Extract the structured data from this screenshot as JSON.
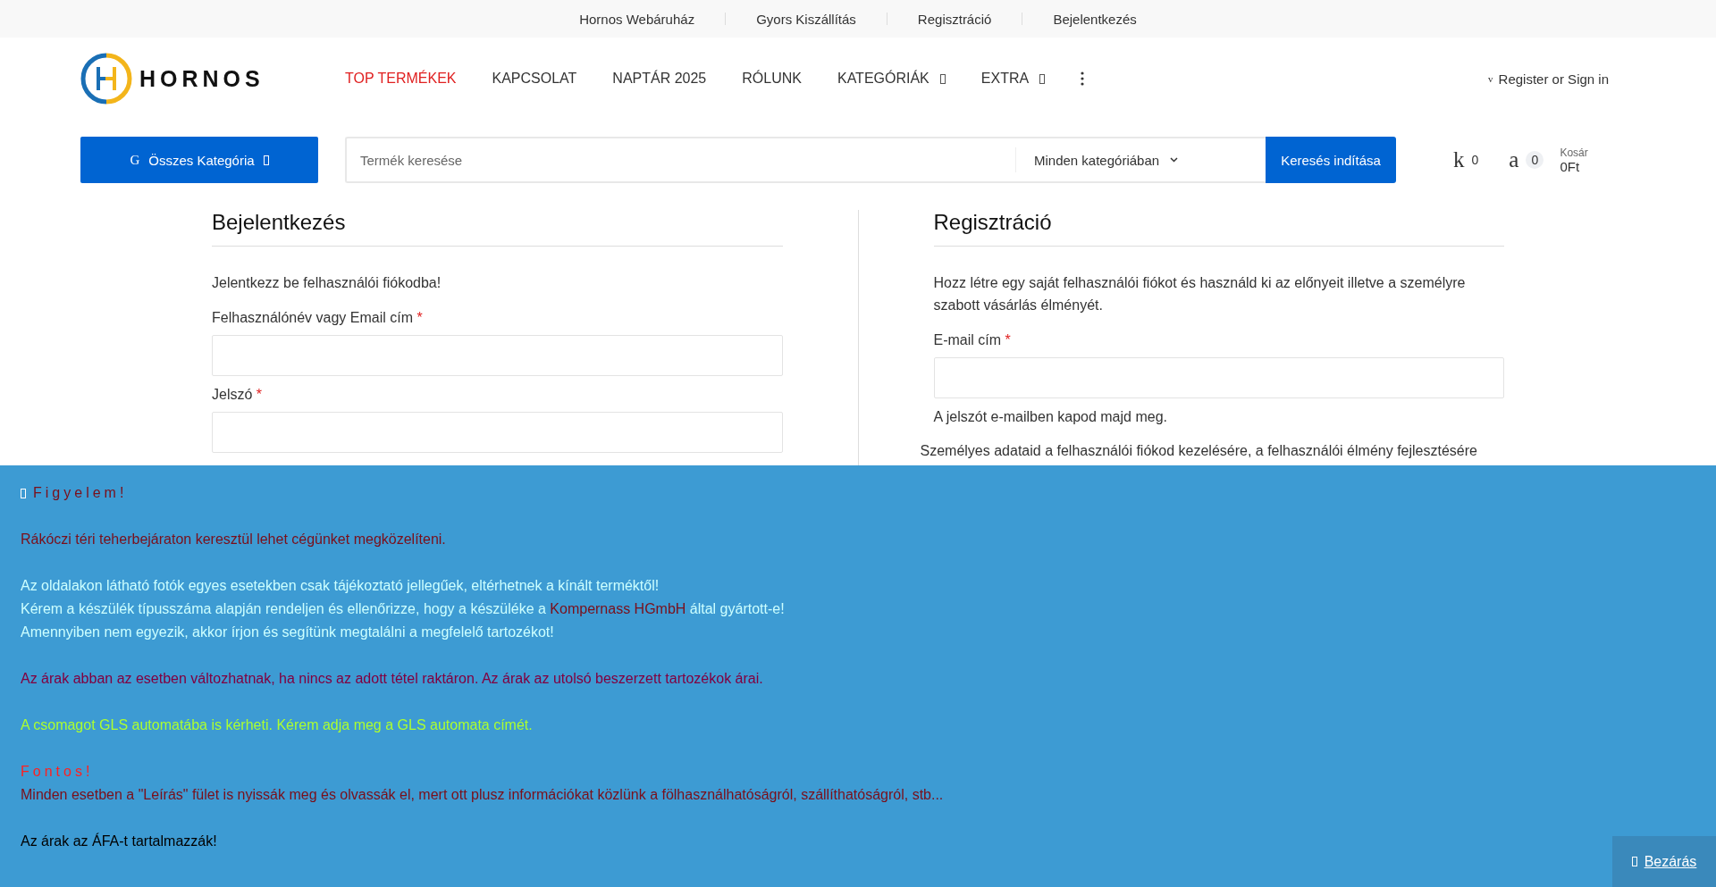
{
  "top_links": [
    "Hornos Webáruház",
    "Gyors Kiszállítás",
    "Regisztráció",
    "Bejelentkezés"
  ],
  "logo": {
    "text": "HORNOS"
  },
  "nav": [
    {
      "label": "TOP TERMÉKEK",
      "highlighted": true,
      "has_dropdown": false
    },
    {
      "label": "KAPCSOLAT",
      "highlighted": false,
      "has_dropdown": false
    },
    {
      "label": "NAPTÁR 2025",
      "highlighted": false,
      "has_dropdown": false
    },
    {
      "label": "RÓLUNK",
      "highlighted": false,
      "has_dropdown": false
    },
    {
      "label": "KATEGÓRIÁK",
      "highlighted": false,
      "has_dropdown": true
    },
    {
      "label": "EXTRA",
      "highlighted": false,
      "has_dropdown": true
    }
  ],
  "account": {
    "glyph": "v",
    "label": "Register or Sign in"
  },
  "category_button": {
    "glyph": "G",
    "label": "Összes Kategória"
  },
  "search": {
    "placeholder": "Termék keresése",
    "category": "Minden kategóriában",
    "button": "Keresés indítása"
  },
  "wishlist": {
    "glyph": "k",
    "count": "0"
  },
  "cart": {
    "glyph": "a",
    "count": "0",
    "label": "Kosár",
    "total": "0Ft"
  },
  "required_mark": "*",
  "login": {
    "title": "Bejelentkezés",
    "intro": "Jelentkezz be felhasználói fiókodba!",
    "fields": [
      {
        "label": "Felhasználónév vagy Email cím",
        "required": true
      },
      {
        "label": "Jelszó",
        "required": true
      }
    ]
  },
  "register": {
    "title": "Regisztráció",
    "intro": "Hozz létre egy saját felhasználói fiókot és használd ki az előnyeit illetve a személyre szabott vásárlás élményét.",
    "fields": [
      {
        "label": "E-mail cím",
        "required": true
      }
    ],
    "note": "A jelszót e-mailben kapod majd meg.",
    "privacy": "Személyes adataid a felhasználói fiókod kezelésére, a felhasználói élmény fejlesztésére"
  },
  "notice": {
    "lines": [
      {
        "kind": "title",
        "segments": [
          {
            "text": "Figyelem!",
            "color": "#7a0f1a"
          }
        ]
      },
      {
        "kind": "blank"
      },
      {
        "kind": "text",
        "segments": [
          {
            "text": "Rákóczi téri teherbejáraton keresztül lehet cégünket megközelíteni.",
            "color": "#7a0f1a"
          }
        ]
      },
      {
        "kind": "blank"
      },
      {
        "kind": "text",
        "segments": [
          {
            "text": "Az oldalakon látható fotók egyes esetekben csak tájékoztató jellegűek, eltérhetnek a kínált terméktől!",
            "color": "#ccffff"
          }
        ]
      },
      {
        "kind": "text",
        "segments": [
          {
            "text": "Kérem a készülék típusszáma alapján rendeljen és ellenőrizze, hogy a készüléke a ",
            "color": "#ccffff"
          },
          {
            "text": "Kompernass HGmbH",
            "color": "#7a0f1a"
          },
          {
            "text": " által gyártott-e!",
            "color": "#ccffff"
          }
        ]
      },
      {
        "kind": "text",
        "segments": [
          {
            "text": "Amennyiben nem egyezik, akkor írjon és segítünk megtalálni a megfelelő tartozékot!",
            "color": "#ccffff"
          }
        ]
      },
      {
        "kind": "blank"
      },
      {
        "kind": "text",
        "segments": [
          {
            "text": "Az árak abban az esetben változhatnak, ha nincs az adott tétel raktáron. Az árak az utolsó beszerzett tartozékok árai.",
            "color": "#800040"
          }
        ]
      },
      {
        "kind": "blank"
      },
      {
        "kind": "text",
        "segments": [
          {
            "text": "A csomagot GLS automatába is kérheti. Kérem adja meg a GLS automata címét.",
            "color": "#adff2f"
          }
        ]
      },
      {
        "kind": "blank"
      },
      {
        "kind": "title",
        "segments": [
          {
            "text": "Fontos!",
            "color": "#ff2020"
          }
        ]
      },
      {
        "kind": "text",
        "segments": [
          {
            "text": "Minden esetben a \"Leírás\" fület is nyissák meg és olvassák el, mert ott plusz információkat közlünk a fölhasználhatóságról, szállíthatóságról, stb...",
            "color": "#7a0f1a"
          }
        ]
      },
      {
        "kind": "blank"
      },
      {
        "kind": "text",
        "segments": [
          {
            "text": "Az árak az ÁFA-t tartalmazzák!",
            "color": "#000000"
          }
        ]
      }
    ]
  },
  "close_button": {
    "label": "Bezárás"
  }
}
